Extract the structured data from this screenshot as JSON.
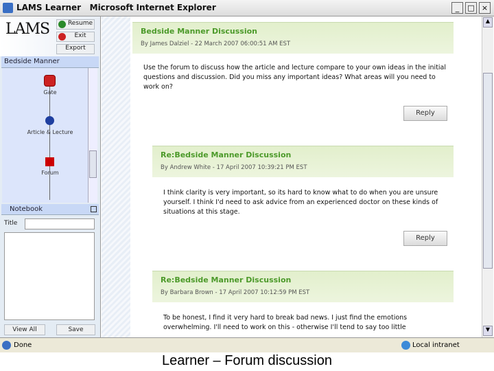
{
  "window": {
    "title": "LAMS Learner   Microsoft Internet Explorer",
    "minimize": "_",
    "maximize": "□",
    "close": "×"
  },
  "sidebar": {
    "logo": "LAMS",
    "resume": "Resume",
    "exit": "Exit",
    "export": "Export",
    "lesson_title": "Bedside Manner",
    "activities": [
      {
        "label": "Gate",
        "color": "#cc2222"
      },
      {
        "label": "Article & Lecture",
        "color": "#1f3fa0"
      },
      {
        "label": "Forum",
        "color": "#cc0000"
      }
    ],
    "notebook": {
      "header": "Notebook",
      "title_label": "Title",
      "title_value": "",
      "view_all": "View All",
      "save": "Save"
    }
  },
  "posts": [
    {
      "title": "Bedside Manner Discussion",
      "byline": "By James Dalziel - 22 March 2007 06:00:51 AM EST",
      "body": "Use the forum to discuss how the article and lecture compare to your own ideas in the initial questions and discussion. Did you miss any important ideas? What areas will you need to work on?",
      "reply": "Reply"
    },
    {
      "title": "Re:Bedside Manner Discussion",
      "byline": "By Andrew White - 17 April 2007 10:39:21 PM EST",
      "body": "I think clarity is very important, so its hard to know what to do when you are unsure yourself. I think I'd need to ask advice from an experienced doctor on these kinds of situations at this stage.",
      "reply": "Reply"
    },
    {
      "title": "Re:Bedside Manner Discussion",
      "byline": "By Barbara Brown - 17 April 2007 10:12:59 PM EST",
      "body": "To be honest, I find it very hard to break bad news. I just find the emotions overwhelming. I'll need to work on this - otherwise I'll tend to say too little"
    }
  ],
  "status": {
    "text": "Done",
    "zone": "Local intranet"
  },
  "caption": "Learner – Forum discussion"
}
